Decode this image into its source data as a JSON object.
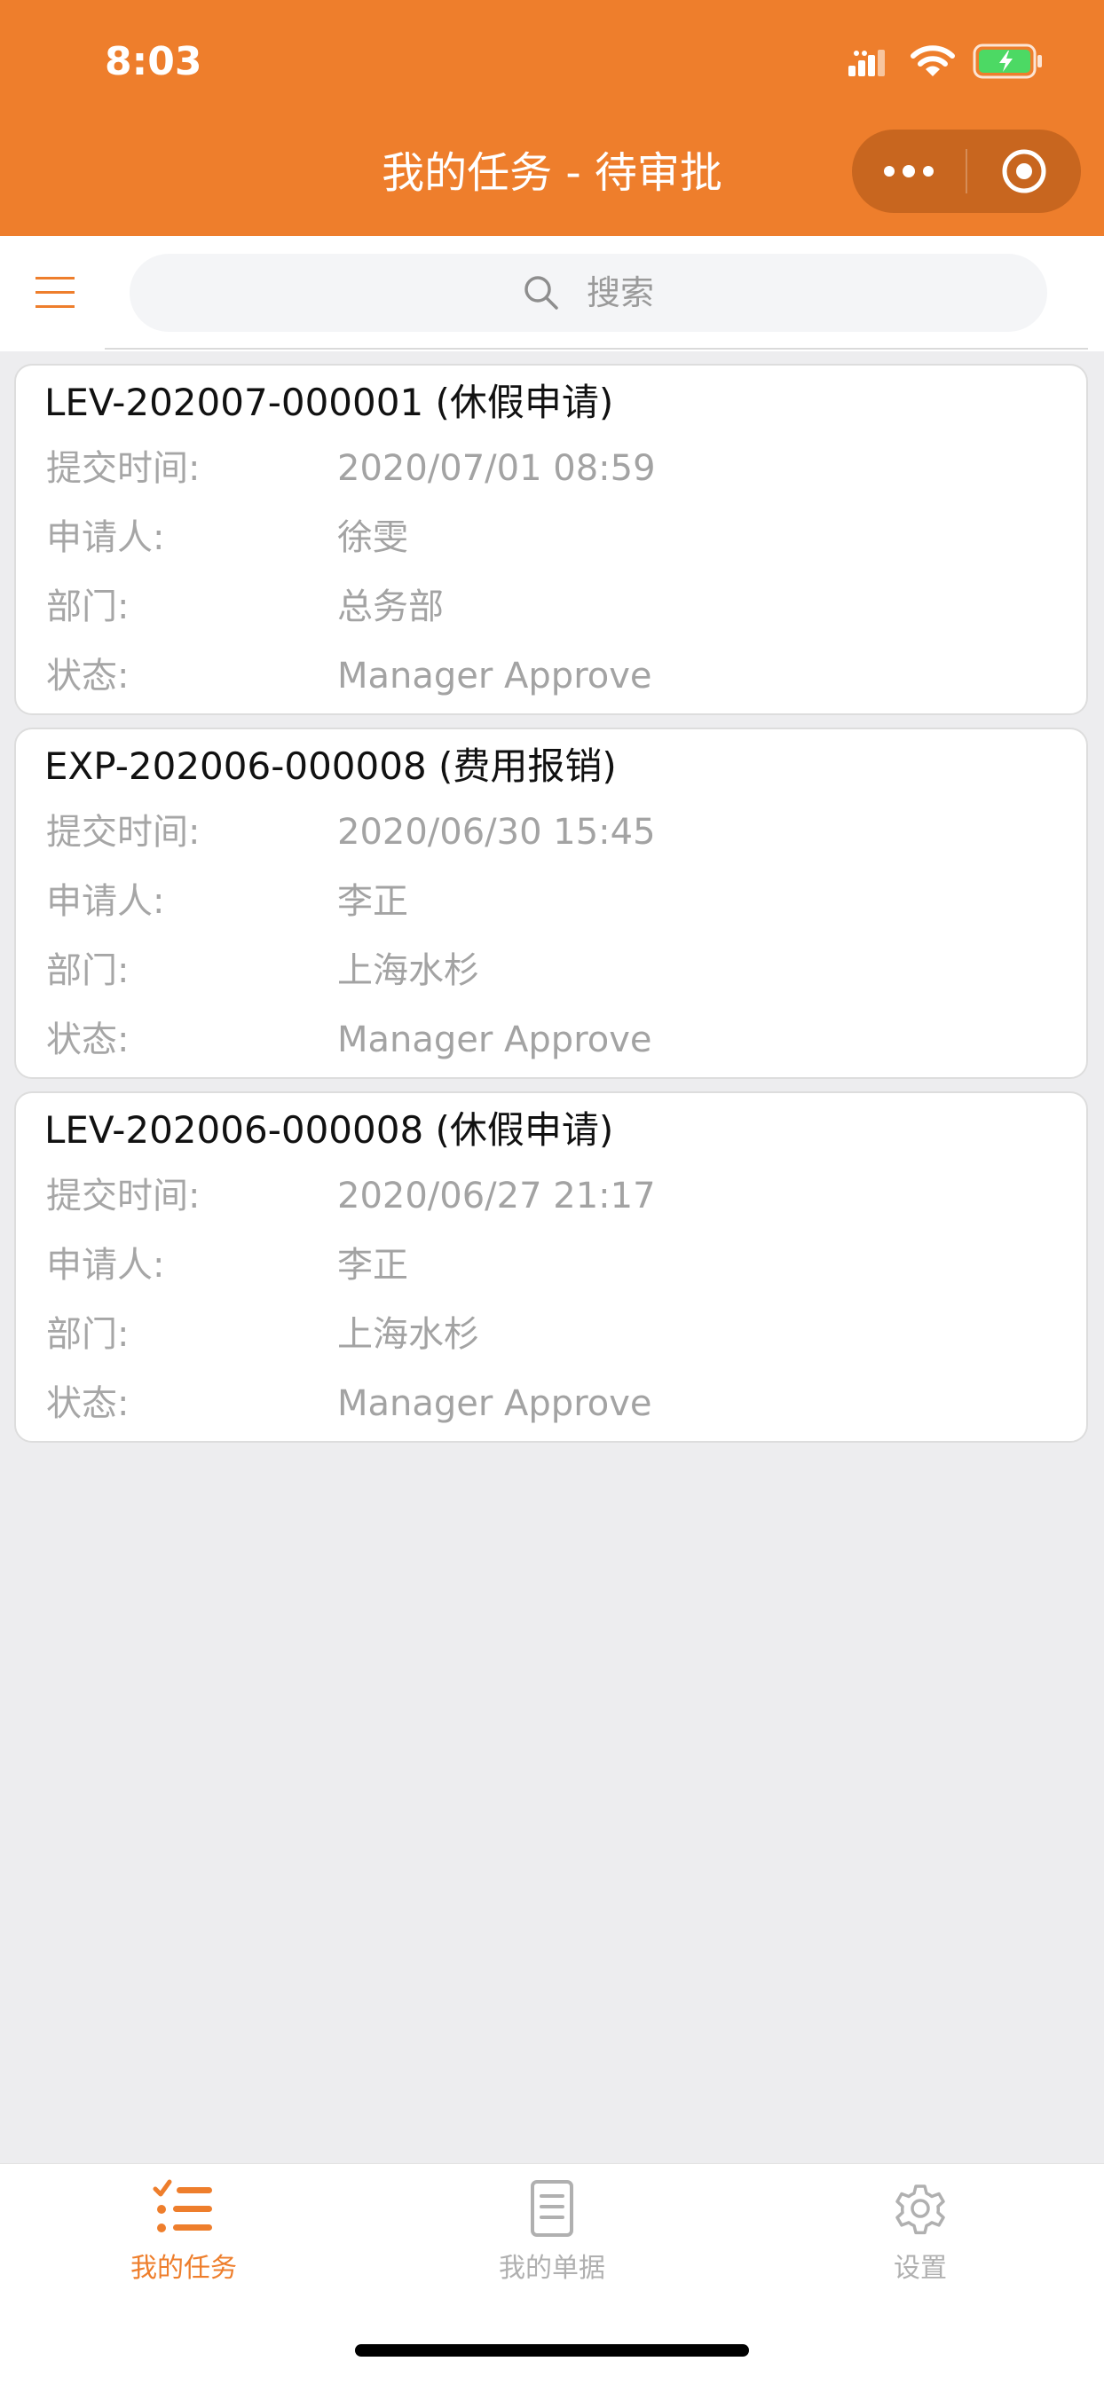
{
  "status_bar": {
    "time": "8:03"
  },
  "nav": {
    "title": "我的任务 - 待审批"
  },
  "colors": {
    "brand": "#EE7E2C",
    "capsule": "#C8661F",
    "tab_active": "#EE7E2C",
    "tab_inactive": "#B0B0B0"
  },
  "search": {
    "placeholder": "搜索"
  },
  "tasks": [
    {
      "title": "LEV-202007-000001 (休假申请)",
      "fields": [
        {
          "label": "提交时间:",
          "value": "2020/07/01 08:59"
        },
        {
          "label": "申请人:",
          "value": "徐雯"
        },
        {
          "label": "部门:",
          "value": "总务部"
        },
        {
          "label": "状态:",
          "value": "Manager Approve"
        }
      ]
    },
    {
      "title": "EXP-202006-000008 (费用报销)",
      "fields": [
        {
          "label": "提交时间:",
          "value": "2020/06/30 15:45"
        },
        {
          "label": "申请人:",
          "value": "李正"
        },
        {
          "label": "部门:",
          "value": "上海水杉"
        },
        {
          "label": "状态:",
          "value": "Manager Approve"
        }
      ]
    },
    {
      "title": "LEV-202006-000008 (休假申请)",
      "fields": [
        {
          "label": "提交时间:",
          "value": "2020/06/27 21:17"
        },
        {
          "label": "申请人:",
          "value": "李正"
        },
        {
          "label": "部门:",
          "value": "上海水杉"
        },
        {
          "label": "状态:",
          "value": "Manager Approve"
        }
      ]
    }
  ],
  "tabbar": {
    "items": [
      {
        "label": "我的任务",
        "icon": "task-list-icon",
        "active": true
      },
      {
        "label": "我的单据",
        "icon": "document-icon",
        "active": false
      },
      {
        "label": "设置",
        "icon": "gear-icon",
        "active": false
      }
    ]
  }
}
